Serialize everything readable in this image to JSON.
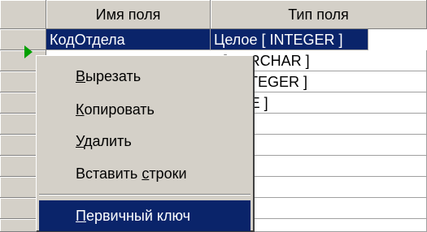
{
  "header": {
    "col_name": "Имя поля",
    "col_type": "Тип поля"
  },
  "rows": [
    {
      "name": "КодОтдела",
      "type": "Целое [ INTEGER ]"
    },
    {
      "name": "",
      "type": "r [ VARCHAR ]"
    },
    {
      "name": "",
      "type": "e [ INTEGER ]"
    },
    {
      "name": "",
      "type": "[ DATE ]"
    }
  ],
  "menu": {
    "cut": {
      "prefix": "",
      "accel": "В",
      "rest": "ырезать"
    },
    "copy": {
      "prefix": "",
      "accel": "К",
      "rest": "опировать"
    },
    "delete": {
      "prefix": "",
      "accel": "У",
      "rest": "далить"
    },
    "insert_rows": {
      "prefix": "Вставить ",
      "accel": "с",
      "rest": "троки"
    },
    "primary_key": {
      "prefix": "",
      "accel": "П",
      "rest": "ервичный ключ"
    }
  },
  "colors": {
    "selection": "#0a246a",
    "face": "#d4d0c8",
    "indicator_arrow": "#00a000"
  }
}
